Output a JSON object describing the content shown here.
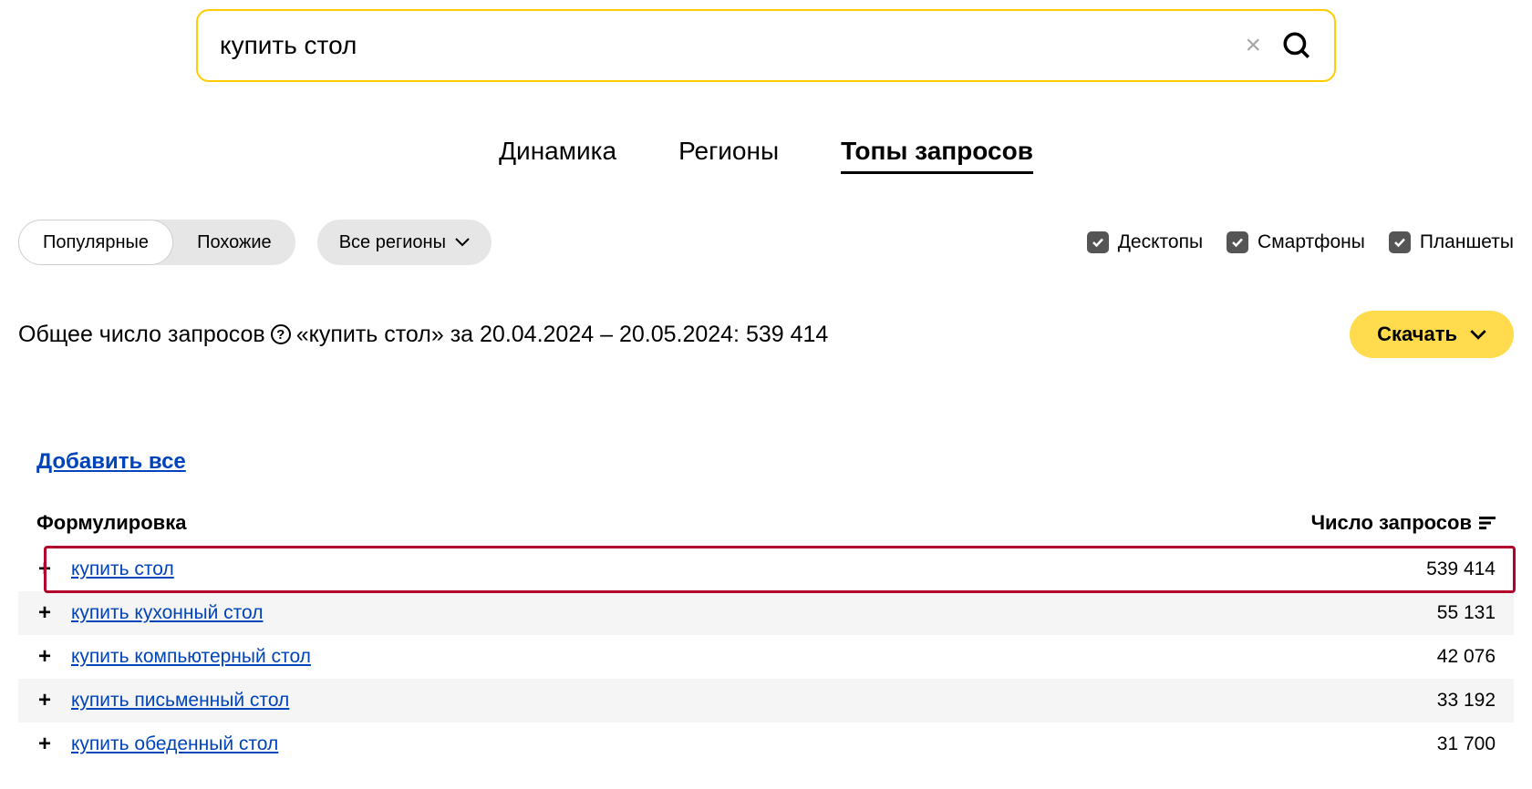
{
  "search": {
    "value": "купить стол"
  },
  "tabs": {
    "dynamics": "Динамика",
    "regions": "Регионы",
    "tops": "Топы запросов"
  },
  "segmented": {
    "popular": "Популярные",
    "similar": "Похожие"
  },
  "region_filter": "Все регионы",
  "devices": {
    "desktops": "Десктопы",
    "smartphones": "Смартфоны",
    "tablets": "Планшеты"
  },
  "summary": {
    "prefix": "Общее число запросов",
    "suffix": "«купить стол» за 20.04.2024 – 20.05.2024: 539 414"
  },
  "download_label": "Скачать",
  "add_all": "Добавить все",
  "columns": {
    "phrase": "Формулировка",
    "count": "Число запросов"
  },
  "rows": [
    {
      "phrase": "купить стол",
      "count": "539 414",
      "highlight": true
    },
    {
      "phrase": "купить кухонный стол",
      "count": "55 131"
    },
    {
      "phrase": "купить компьютерный стол",
      "count": "42 076"
    },
    {
      "phrase": "купить письменный стол",
      "count": "33 192"
    },
    {
      "phrase": "купить обеденный стол",
      "count": "31 700"
    }
  ]
}
